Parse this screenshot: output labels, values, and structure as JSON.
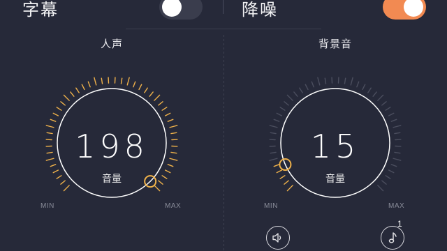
{
  "header": {
    "subtitles": {
      "label": "字幕",
      "state": "off"
    },
    "noise_reduction": {
      "label": "降噪",
      "state": "on"
    }
  },
  "colors": {
    "background": "#262939",
    "accent": "#f0b24a",
    "toggle_on": "#f28a52",
    "toggle_off": "#3a3d4d",
    "tick_inactive": "#4b4e5e"
  },
  "voice": {
    "title": "人声",
    "value": "198",
    "unit": "音量",
    "min_label": "MIN",
    "max_label": "MAX",
    "level": 1.0
  },
  "background_sound": {
    "title": "背景音",
    "value": "15",
    "unit": "音量",
    "min_label": "MIN",
    "max_label": "MAX",
    "level": 0.08,
    "buttons": {
      "speaker_icon": "speaker-icon",
      "music_icon": "music-note-icon",
      "music_badge": "1"
    }
  }
}
